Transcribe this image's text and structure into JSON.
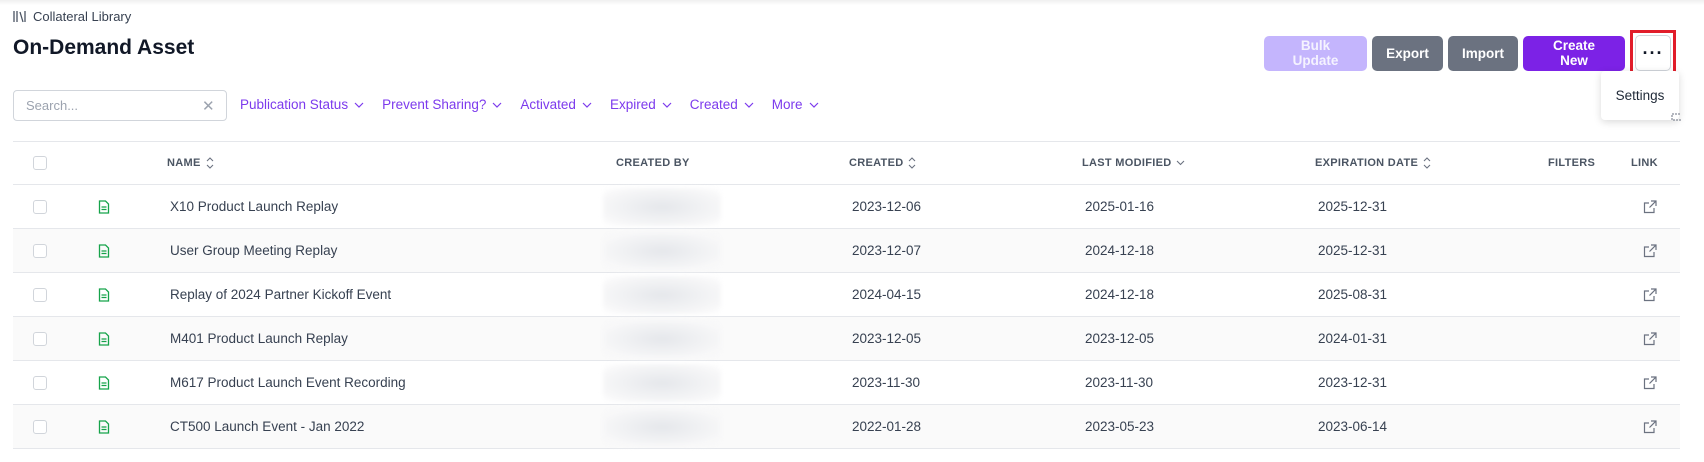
{
  "breadcrumb": {
    "label": "Collateral Library",
    "icon": "library-icon"
  },
  "page_title": "On-Demand Asset",
  "actions": {
    "bulk_update": "Bulk Update",
    "export": "Export",
    "import": "Import",
    "create_new": "Create New",
    "more": "···"
  },
  "more_menu": {
    "items": [
      "Settings"
    ]
  },
  "search": {
    "placeholder": "Search...",
    "value": "",
    "clear": "✕"
  },
  "filters": [
    "Publication Status",
    "Prevent Sharing?",
    "Activated",
    "Expired",
    "Created",
    "More"
  ],
  "table": {
    "columns": {
      "name": "NAME",
      "created_by": "CREATED BY",
      "created": "CREATED",
      "last_modified": "LAST MODIFIED",
      "expiration_date": "EXPIRATION DATE",
      "filters": "FILTERS",
      "link": "LINK"
    },
    "rows": [
      {
        "name": "X10 Product Launch Replay",
        "created": "2023-12-06",
        "last_modified": "2025-01-16",
        "expiration_date": "2025-12-31"
      },
      {
        "name": "User Group Meeting Replay",
        "created": "2023-12-07",
        "last_modified": "2024-12-18",
        "expiration_date": "2025-12-31"
      },
      {
        "name": "Replay of 2024 Partner Kickoff Event",
        "created": "2024-04-15",
        "last_modified": "2024-12-18",
        "expiration_date": "2025-08-31"
      },
      {
        "name": "M401 Product Launch Replay",
        "created": "2023-12-05",
        "last_modified": "2023-12-05",
        "expiration_date": "2024-01-31"
      },
      {
        "name": "M617 Product Launch Event Recording",
        "created": "2023-11-30",
        "last_modified": "2023-11-30",
        "expiration_date": "2023-12-31"
      },
      {
        "name": "CT500 Launch Event - Jan 2022",
        "created": "2022-01-28",
        "last_modified": "2023-05-23",
        "expiration_date": "2023-06-14"
      }
    ]
  },
  "colors": {
    "accent": "#7c22e6",
    "accent_light": "#c4b5fd",
    "secondary": "#6b7280",
    "highlight": "#e11d2a",
    "file_icon": "#16a34a"
  }
}
